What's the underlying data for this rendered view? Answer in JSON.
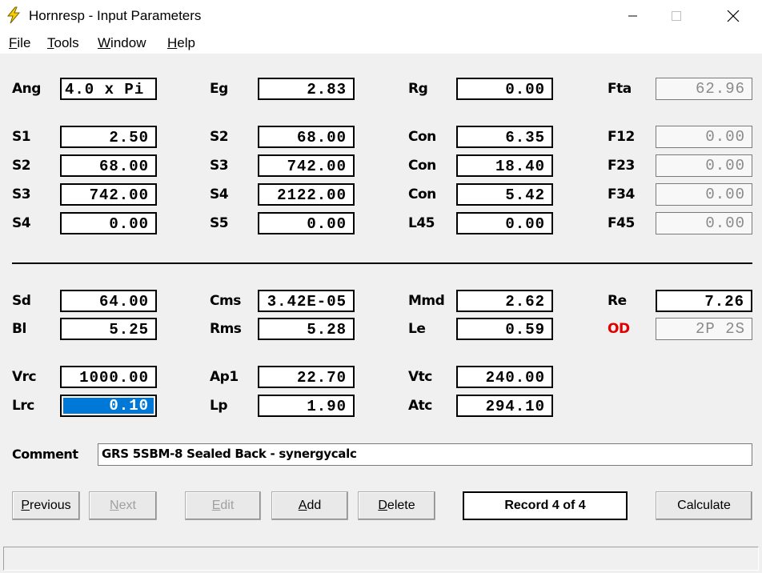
{
  "window": {
    "title": "Hornresp - Input Parameters"
  },
  "menu": [
    {
      "pre": "",
      "ul": "F",
      "post": "ile"
    },
    {
      "pre": "",
      "ul": "T",
      "post": "ools"
    },
    {
      "pre": "",
      "ul": "W",
      "post": "indow"
    },
    {
      "pre": "",
      "ul": "H",
      "post": "elp"
    }
  ],
  "params": {
    "ang": {
      "label": "Ang",
      "value": "4.0 x Pi"
    },
    "eg": {
      "label": "Eg",
      "value": "2.83"
    },
    "rg": {
      "label": "Rg",
      "value": "0.00"
    },
    "fta": {
      "label": "Fta",
      "value": "62.96"
    },
    "s1": {
      "label": "S1",
      "value": "2.50"
    },
    "s2a": {
      "label": "S2",
      "value": "68.00"
    },
    "con1": {
      "label": "Con",
      "value": "6.35"
    },
    "f12": {
      "label": "F12",
      "value": "0.00"
    },
    "s2b": {
      "label": "S2",
      "value": "68.00"
    },
    "s3a": {
      "label": "S3",
      "value": "742.00"
    },
    "con2": {
      "label": "Con",
      "value": "18.40"
    },
    "f23": {
      "label": "F23",
      "value": "0.00"
    },
    "s3b": {
      "label": "S3",
      "value": "742.00"
    },
    "s4a": {
      "label": "S4",
      "value": "2122.00"
    },
    "con3": {
      "label": "Con",
      "value": "5.42"
    },
    "f34": {
      "label": "F34",
      "value": "0.00"
    },
    "s4b": {
      "label": "S4",
      "value": "0.00"
    },
    "s5": {
      "label": "S5",
      "value": "0.00"
    },
    "l45": {
      "label": "L45",
      "value": "0.00"
    },
    "f45": {
      "label": "F45",
      "value": "0.00"
    },
    "sd": {
      "label": "Sd",
      "value": "64.00"
    },
    "cms": {
      "label": "Cms",
      "value": "3.42E-05"
    },
    "mmd": {
      "label": "Mmd",
      "value": "2.62"
    },
    "re": {
      "label": "Re",
      "value": "7.26"
    },
    "bl": {
      "label": "Bl",
      "value": "5.25"
    },
    "rms": {
      "label": "Rms",
      "value": "5.28"
    },
    "le": {
      "label": "Le",
      "value": "0.59"
    },
    "od": {
      "label": "OD",
      "value": "2P 2S"
    },
    "vrc": {
      "label": "Vrc",
      "value": "1000.00"
    },
    "ap1": {
      "label": "Ap1",
      "value": "22.70"
    },
    "vtc": {
      "label": "Vtc",
      "value": "240.00"
    },
    "lrc": {
      "label": "Lrc",
      "value": "0.10"
    },
    "lp": {
      "label": "Lp",
      "value": "1.90"
    },
    "atc": {
      "label": "Atc",
      "value": "294.10"
    }
  },
  "comment": {
    "label": "Comment",
    "value": "GRS 5SBM-8 Sealed Back - synergycalc"
  },
  "buttons": {
    "previous": {
      "ul": "P",
      "rest": "revious"
    },
    "next": {
      "ul": "N",
      "rest": "ext"
    },
    "edit": {
      "ul": "E",
      "rest": "dit"
    },
    "add": {
      "ul": "A",
      "rest": "dd"
    },
    "delete": {
      "ul": "D",
      "rest": "elete"
    },
    "record": "Record 4 of 4",
    "calculate": "Calculate"
  },
  "colors": {
    "selection": "#0078d7",
    "od_label": "#e00000"
  },
  "icons": [
    "lightning-icon",
    "minimize-icon",
    "maximize-icon",
    "close-icon"
  ]
}
